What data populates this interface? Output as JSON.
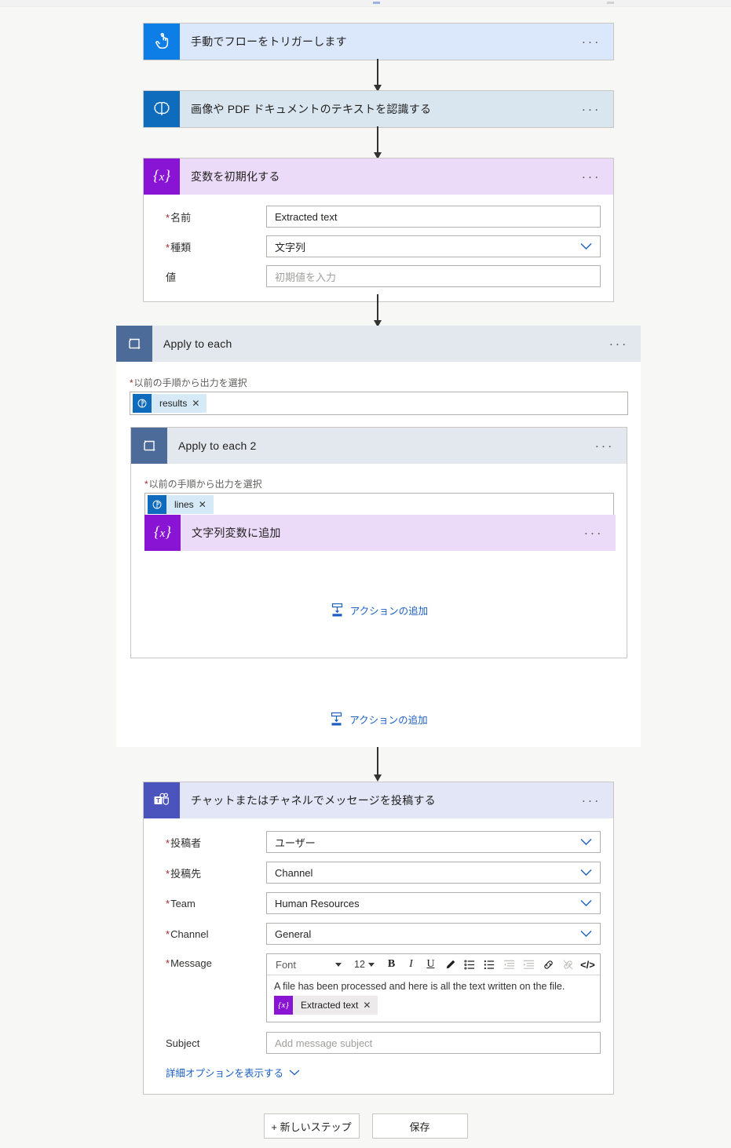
{
  "app": "power-automate-flow-designer",
  "steps": {
    "trigger": {
      "title": "手動でフローをトリガーします",
      "icon": "manual-trigger-hand-icon",
      "menu": "···"
    },
    "ocr": {
      "title": "画像や PDF ドキュメントのテキストを認識する",
      "icon": "ai-builder-brain-icon",
      "menu": "···"
    },
    "init_variable": {
      "title": "変数を初期化する",
      "icon": "variable-braces-icon",
      "menu": "···",
      "fields": [
        {
          "label": "名前",
          "required": true,
          "value": "Extracted text",
          "type": "text"
        },
        {
          "label": "種類",
          "required": true,
          "value": "文字列",
          "type": "select"
        },
        {
          "label": "値",
          "required": false,
          "value": "",
          "placeholder": "初期値を入力",
          "type": "text"
        }
      ]
    },
    "apply_to_each": {
      "title": "Apply to each",
      "icon": "loop-repeat-icon",
      "menu": "···",
      "scope_label": "以前の手順から出力を選択",
      "scope_required": true,
      "token": {
        "text": "results",
        "icon": "ai-builder-brain-icon",
        "remove": "✕"
      },
      "add_action_label": "アクションの追加"
    },
    "apply_to_each_2": {
      "title": "Apply to each 2",
      "icon": "loop-repeat-icon",
      "menu": "···",
      "scope_label": "以前の手順から出力を選択",
      "scope_required": true,
      "token": {
        "text": "lines",
        "icon": "ai-builder-brain-icon",
        "remove": "✕"
      },
      "add_action_label": "アクションの追加"
    },
    "append_to_string": {
      "title": "文字列変数に追加",
      "icon": "variable-braces-icon",
      "menu": "···"
    },
    "post_message": {
      "title": "チャットまたはチャネルでメッセージを投稿する",
      "icon": "microsoft-teams-icon",
      "menu": "···",
      "fields": [
        {
          "label": "投稿者",
          "required": true,
          "value": "ユーザー",
          "type": "select"
        },
        {
          "label": "投稿先",
          "required": true,
          "value": "Channel",
          "type": "select"
        },
        {
          "label": "Team",
          "required": true,
          "value": "Human Resources",
          "type": "select"
        },
        {
          "label": "Channel",
          "required": true,
          "value": "General",
          "type": "select"
        }
      ],
      "message": {
        "label": "Message",
        "required": true,
        "toolbar": {
          "font_name": "Font",
          "font_size": "12",
          "bold": "B",
          "italic": "I",
          "underline": "U",
          "highlight": "highlighter-pen-icon",
          "numbered_list": "numbered-list-icon",
          "bulleted_list": "bulleted-list-icon",
          "outdent": "decrease-indent-icon",
          "indent": "increase-indent-icon",
          "link": "link-icon",
          "unlink": "unlink-icon",
          "code": "</>"
        },
        "body_text": "A file has been processed and here is all the text written on the file.",
        "token": {
          "text": "Extracted text",
          "icon": "variable-braces-icon",
          "remove": "✕"
        }
      },
      "subject": {
        "label": "Subject",
        "required": false,
        "value": "",
        "placeholder": "Add message subject"
      },
      "advanced_link": "詳細オプションを表示する"
    }
  },
  "footer": {
    "new_step_button": "+ 新しいステップ",
    "save_button": "保存"
  },
  "colors": {
    "trigger_blue": "#0d7ee6",
    "ocr_blue": "#0f6cbd",
    "variable_purple": "#8a14d4",
    "loop_slate": "#4c6b99",
    "teams_indigo": "#4b53bc",
    "link_blue": "#1b5ec2",
    "required_red": "#a4262c",
    "canvas_bg": "#f7f7f5"
  }
}
